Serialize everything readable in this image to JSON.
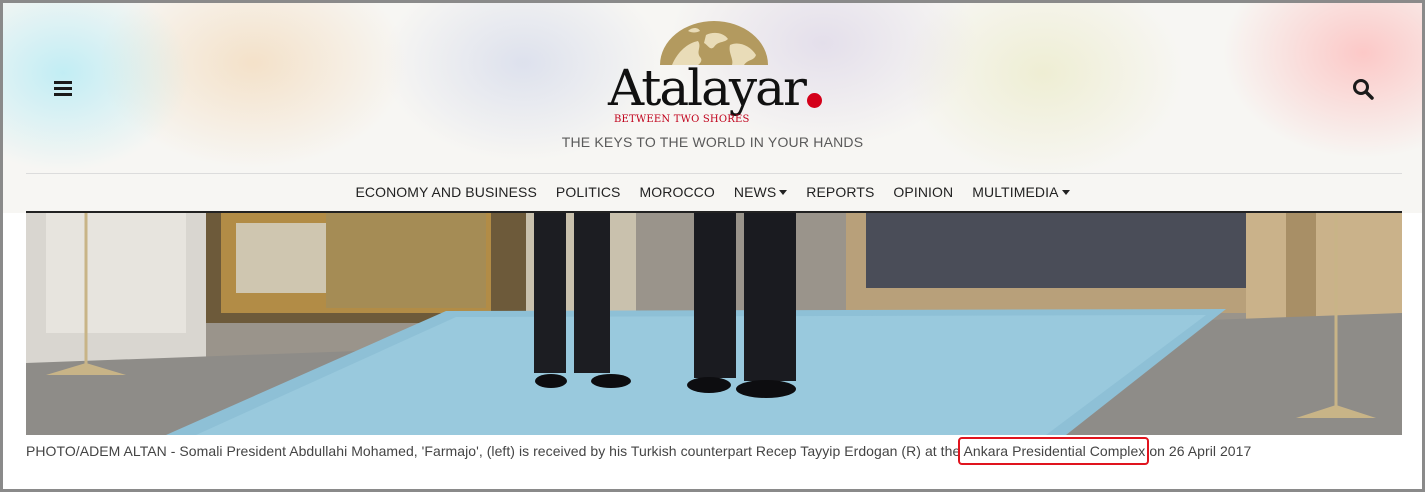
{
  "header": {
    "logo": {
      "wordmark": "Atalayar",
      "subtitle": "BETWEEN TWO SHORES",
      "dot_color": "#d4001a"
    },
    "tagline": "THE KEYS TO THE WORLD IN YOUR HANDS",
    "menu_icon": "hamburger-menu-icon",
    "search_icon": "search-icon"
  },
  "nav": {
    "items": [
      {
        "label": "ECONOMY AND BUSINESS",
        "dropdown": false
      },
      {
        "label": "POLITICS",
        "dropdown": false
      },
      {
        "label": "MOROCCO",
        "dropdown": false
      },
      {
        "label": "NEWS",
        "dropdown": true
      },
      {
        "label": "REPORTS",
        "dropdown": false
      },
      {
        "label": "OPINION",
        "dropdown": false
      },
      {
        "label": "MULTIMEDIA",
        "dropdown": true
      }
    ]
  },
  "article": {
    "caption_before": "PHOTO/ADEM ALTAN - Somali President Abdullahi Mohamed, 'Farmajo', (left) is received by his Turkish counterpart Recep Tayyip Erdogan (R) at the",
    "caption_highlight": "Ankara Presidential Complex",
    "caption_after": "on 26 April 2017",
    "highlight_color": "#e0141e"
  }
}
